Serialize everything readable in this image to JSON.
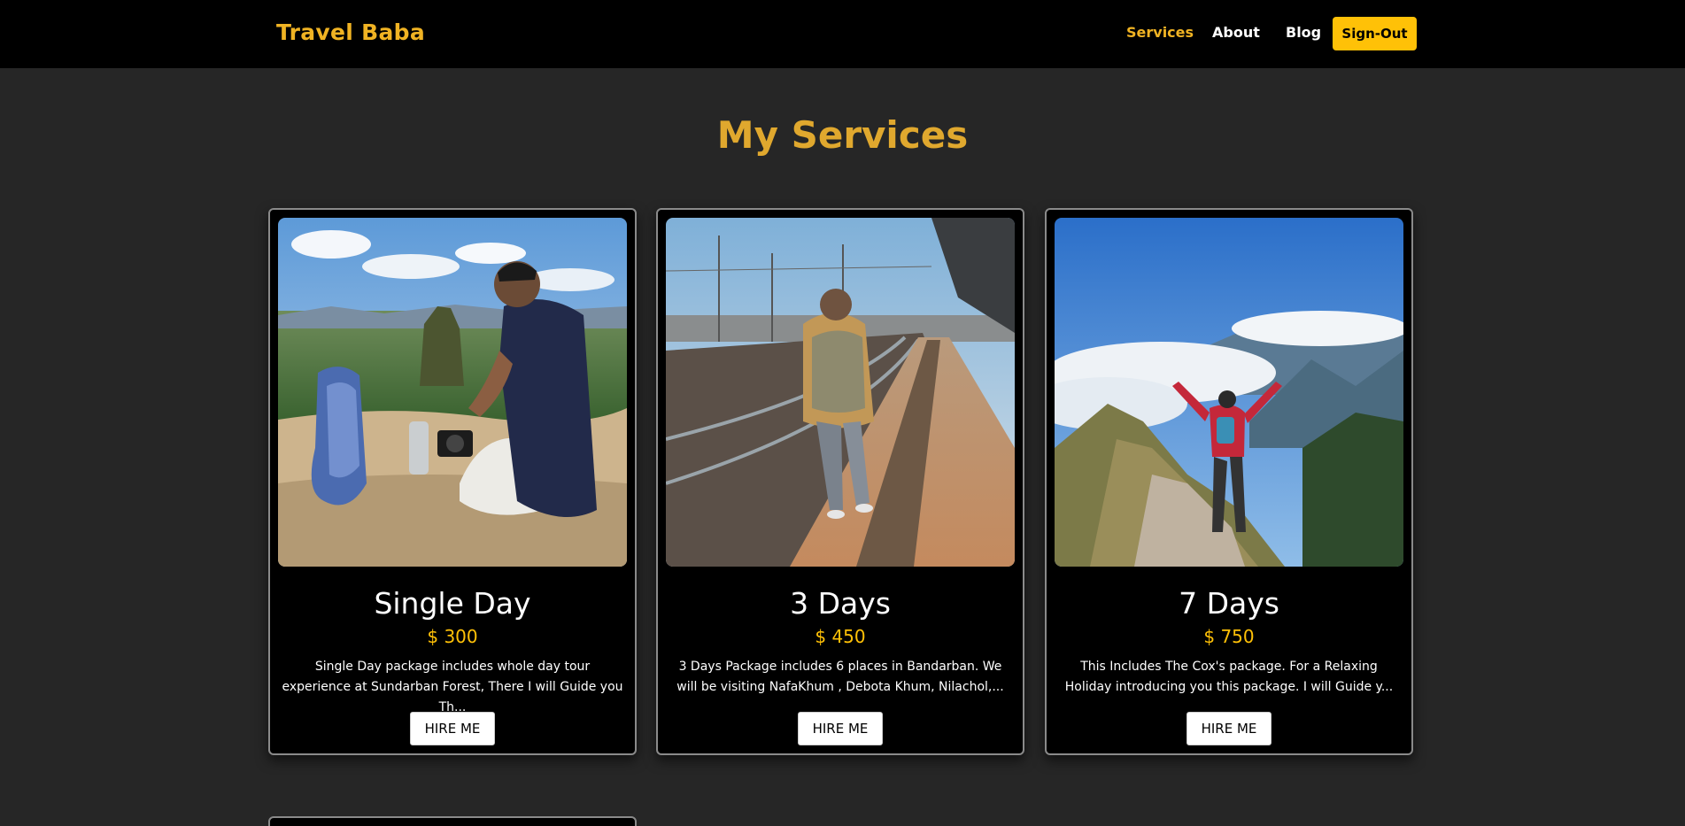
{
  "navbar": {
    "brand": "Travel Baba",
    "links": [
      {
        "label": "Services",
        "active": true
      },
      {
        "label": "About",
        "active": false
      },
      {
        "label": "Blog",
        "active": false
      }
    ],
    "signout_label": "Sign-Out"
  },
  "page": {
    "heading": "My Services"
  },
  "services": [
    {
      "title": "Single Day",
      "price": "$ 300",
      "description": "Single Day package includes whole day tour experience at Sundarban Forest, There I will Guide you Th...",
      "button_label": "HIRE ME",
      "image": "traveler sitting on cliff overlooking rock and valley"
    },
    {
      "title": "3 Days",
      "price": "$ 450",
      "description": "3 Days Package includes 6 places in Bandarban. We will be visiting NafaKhum , Debota Khum, Nilachol,...",
      "button_label": "HIRE ME",
      "image": "traveler with backpack walking on train platform"
    },
    {
      "title": "7 Days",
      "price": "$ 750",
      "description": "This Includes The Cox's package. For a Relaxing Holiday introducing you this package. I will Guide y...",
      "button_label": "HIRE ME",
      "image": "hiker with arms raised on mountain ridge above clouds"
    }
  ],
  "colors": {
    "accent": "#f0b323",
    "button_yellow": "#ffc107",
    "background": "#262626",
    "card": "#000000"
  }
}
